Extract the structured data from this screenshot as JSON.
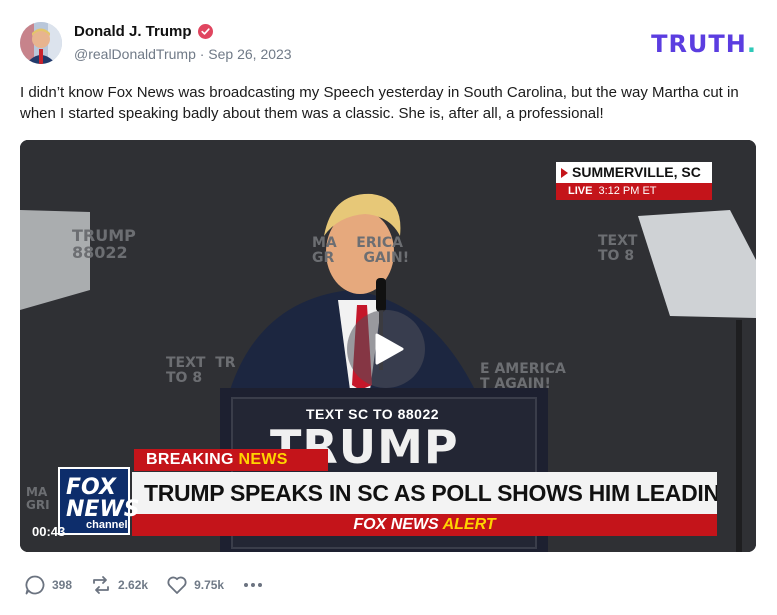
{
  "post": {
    "author_name": "Donald J. Trump",
    "handle_line": "@realDonaldTrump · Sep 26, 2023",
    "brand": "TRUTH",
    "brand_dot": ".",
    "text": "I didn’t know Fox News was broadcasting my Speech yesterday in South Carolina, but the way Martha cut in when I started speaking badly about them was a classic. She is, after all, a professional!"
  },
  "video": {
    "duration": "00:43",
    "location": "SUMMERVILLE, SC",
    "live": "LIVE",
    "time": "3:12 PM ET",
    "breaking": "BREAKING",
    "breaking_news": "NEWS",
    "headline": "TRUMP SPEAKS IN SC AS POLL SHOWS HIM LEADING BIDEN",
    "alert_brand": "FOX NEWS",
    "alert_word": "ALERT",
    "podium_line": "TEXT SC TO 88022",
    "podium_name": "TRUMP",
    "fox_logo_fox": "FOX",
    "fox_logo_news": "NEWS",
    "fox_logo_channel": "channel",
    "bg_trump": "TRUMP",
    "bg_number": "88022",
    "bg_text_right": "TEXT",
    "bg_to_right": "TO 8",
    "bg_maga_1": "MA    ERICA",
    "bg_maga_2": "GR      GAIN!",
    "bg_text_left": "TEXT  TR",
    "bg_to_left": "TO 8",
    "bg_america": "E AMERICA",
    "bg_again": "T AGAIN!",
    "bg_ma_left": "MA",
    "bg_gr_left": "GRI"
  },
  "actions": {
    "replies": "398",
    "retruths": "2.62k",
    "likes": "9.75k"
  },
  "colors": {
    "brand_purple": "#5b3de0",
    "brand_teal": "#2fc9b8",
    "fox_red": "#c4141a",
    "alert_yellow": "#ffd400",
    "verified_pink": "#e0455f"
  }
}
